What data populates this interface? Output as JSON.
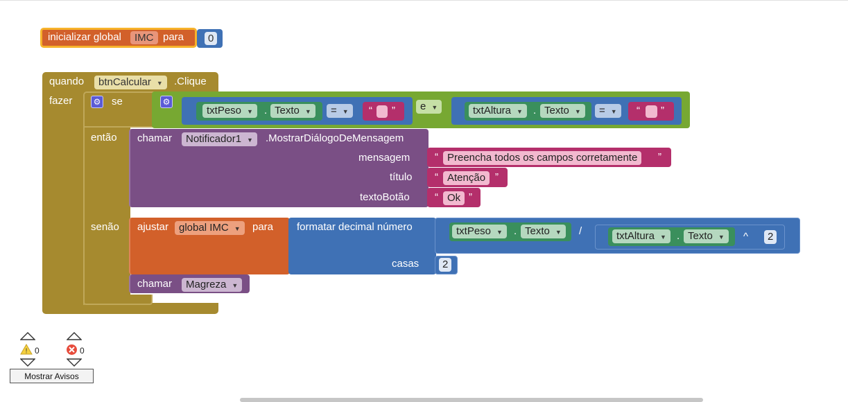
{
  "init_block": {
    "prefix": "inicializar global",
    "var_name": "IMC",
    "suffix": "para",
    "value": "0"
  },
  "event_block": {
    "when": "quando",
    "component": "btnCalcular",
    "event": ".Clique",
    "do": "fazer",
    "if_label": "se",
    "then_label": "então",
    "else_label": "senão"
  },
  "condition": {
    "left": {
      "component": "txtPeso",
      "dot": ".",
      "property": "Texto",
      "op": "=",
      "string": ""
    },
    "and_op": "e",
    "right": {
      "component": "txtAltura",
      "dot": ".",
      "property": "Texto",
      "op": "=",
      "string": ""
    }
  },
  "then_call": {
    "call": "chamar",
    "component": "Notificador1",
    "method": ".MostrarDiálogoDeMensagem",
    "params": [
      {
        "label": "mensagem",
        "value": "Preencha todos os campos corretamente"
      },
      {
        "label": "título",
        "value": "Atenção"
      },
      {
        "label": "textoBotão",
        "value": "Ok"
      }
    ]
  },
  "else_set": {
    "set": "ajustar",
    "var": "global IMC",
    "to": "para",
    "format": "formatar decimal número",
    "places_label": "casas",
    "places_value": "2",
    "num": {
      "component": "txtPeso",
      "dot": ".",
      "property": "Texto"
    },
    "div_op": "/",
    "den": {
      "component": "txtAltura",
      "dot": ".",
      "property": "Texto"
    },
    "pow_op": "^",
    "pow_value": "2"
  },
  "else_call": {
    "call": "chamar",
    "procedure": "Magreza"
  },
  "warnings": {
    "warn_count": "0",
    "error_count": "0",
    "button": "Mostrar Avisos"
  },
  "colors": {
    "event": "#a68a2f",
    "logic": "#77a832",
    "compare": "#3f71b5",
    "component": "#3a8f5c",
    "text": "#b42f6b",
    "procedure": "#7a4f85",
    "variable": "#d2602a",
    "math": "#3f71b5"
  }
}
